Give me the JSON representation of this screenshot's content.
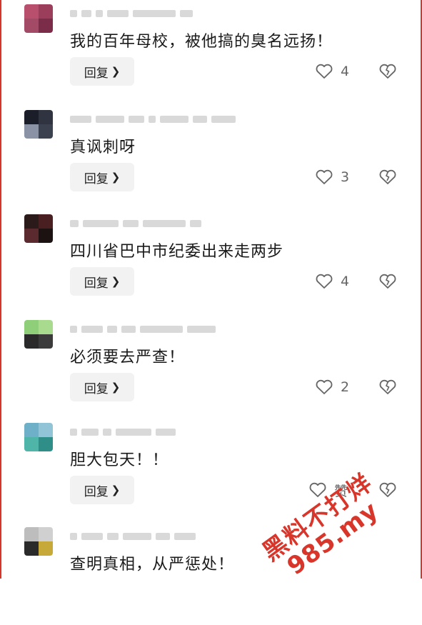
{
  "reply_label": "回复",
  "comments": [
    {
      "text": "我的百年母校，被他搞的臭名远扬！",
      "like_count": "4",
      "colors": [
        "#b8506d",
        "#9a3e5c",
        "#a24a66",
        "#7a2c49"
      ]
    },
    {
      "text": "真讽刺呀",
      "like_count": "3",
      "colors": [
        "#1b1e28",
        "#2f3440",
        "#8a93a6",
        "#3b414f"
      ]
    },
    {
      "text": "四川省巴中市纪委出来走两步",
      "like_count": "4",
      "colors": [
        "#2b1a1a",
        "#4a1f22",
        "#5b2a2e",
        "#1d1212"
      ]
    },
    {
      "text": "必须要去严查！",
      "like_count": "2",
      "colors": [
        "#8fcf79",
        "#a9db8f",
        "#2a2a2a",
        "#3b3b3b"
      ]
    },
    {
      "text": "胆大包天！！",
      "like_count": "赞",
      "colors": [
        "#6fb0c9",
        "#90c4d6",
        "#4fb5a8",
        "#2f8f88"
      ]
    },
    {
      "text": "查明真相，从严惩处！",
      "like_count": "",
      "colors": [
        "#bdbdbd",
        "#d0d0d0",
        "#2a2a2a",
        "#c7a93a"
      ]
    }
  ],
  "watermark": {
    "line1": "黑料不打烊",
    "line2": "985.my"
  },
  "accent_color": "#d9362b"
}
